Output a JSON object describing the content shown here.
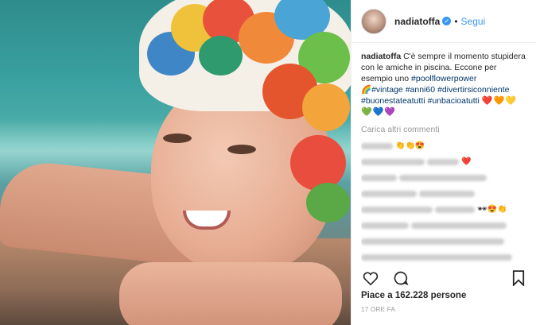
{
  "post": {
    "username": "nadiatoffa",
    "verified_symbol": "✓",
    "separator": "•",
    "follow_label": "Segui",
    "caption_user": "nadiatoffa",
    "caption_text": " C'è sempre il momento stupidera con le amiche in piscina. Eccone per esempio uno ",
    "hashtag_1": "#poolflowerpower",
    "rainbow": "🌈",
    "hashtag_2": "#vintage",
    "hashtag_3": "#anni60",
    "hashtag_4": "#divertirsiconniente",
    "hashtag_5": "#buonestateatutti",
    "hashtag_6": "#unbacioatutti",
    "hearts_line1": "❤️🧡💛",
    "hearts_line2": "💚💙💜",
    "load_more": "Carica altri commenti",
    "likes": "Piace a 162.228 persone",
    "timestamp": "17 ORE FA"
  },
  "colors": {
    "link": "#003569",
    "follow": "#3897f0",
    "muted": "#999999"
  },
  "icons": {
    "like": "heart-icon",
    "comment": "comment-icon",
    "save": "bookmark-icon",
    "verified": "verified-badge-icon"
  }
}
